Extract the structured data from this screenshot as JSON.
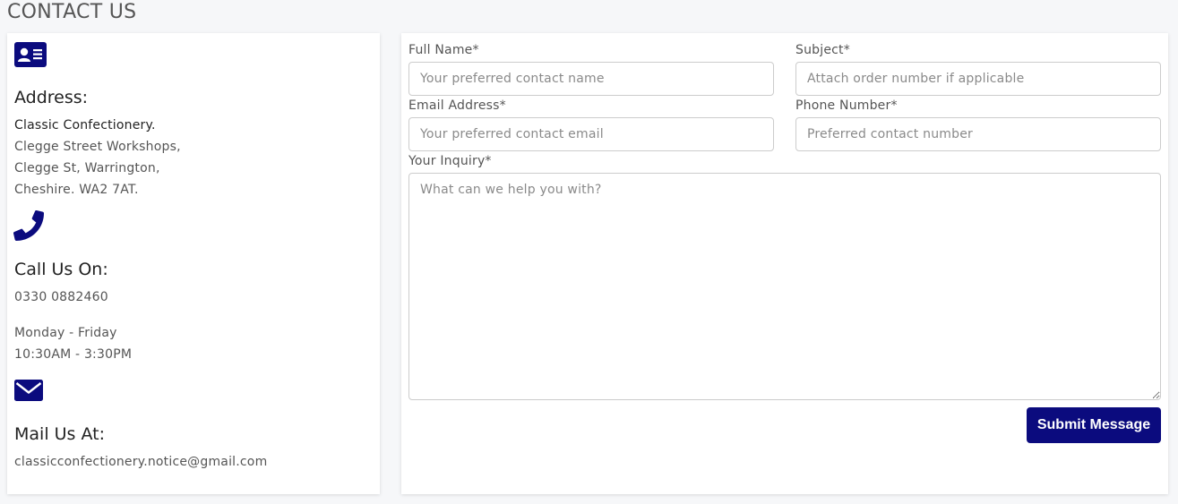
{
  "page": {
    "title": "CONTACT US"
  },
  "contact_info": {
    "address": {
      "icon": "address-card-icon",
      "heading": "Address:",
      "lines": [
        "Classic Confectionery.",
        "Clegge Street Workshops,",
        "Clegge St, Warrington,",
        "Cheshire. WA2 7AT."
      ]
    },
    "phone": {
      "icon": "phone-icon",
      "heading": "Call Us On:",
      "number": "0330 0882460",
      "days": "Monday - Friday",
      "hours": "10:30AM - 3:30PM"
    },
    "mail": {
      "icon": "envelope-icon",
      "heading": "Mail Us At:",
      "email": "classicconfectionery.notice@gmail.com"
    }
  },
  "form": {
    "full_name": {
      "label": "Full Name*",
      "placeholder": "Your preferred contact name"
    },
    "subject": {
      "label": "Subject*",
      "placeholder": "Attach order number if applicable"
    },
    "email": {
      "label": "Email Address*",
      "placeholder": "Your preferred contact email"
    },
    "phone": {
      "label": "Phone Number*",
      "placeholder": "Preferred contact number"
    },
    "inquiry": {
      "label": "Your Inquiry*",
      "placeholder": "What can we help you with?"
    },
    "submit_label": "Submit Message"
  },
  "colors": {
    "accent": "#0b0b7e",
    "background": "#f6f7f9"
  }
}
